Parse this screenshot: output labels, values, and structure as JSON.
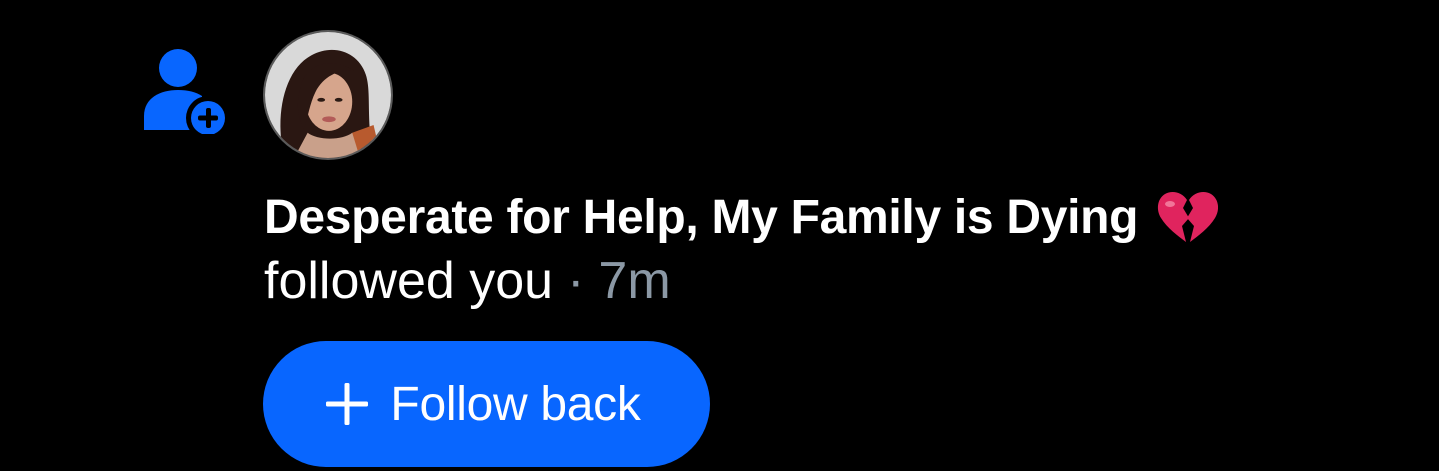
{
  "notification": {
    "type_icon": "person-add-icon",
    "avatar_icon": "user-avatar",
    "display_name": "Desperate for Help, My Family is Dying",
    "name_emoji": "broken-heart-emoji",
    "action_text": "followed you",
    "separator": "·",
    "timestamp": "7m",
    "button": {
      "icon": "plus-icon",
      "label": "Follow back"
    }
  },
  "colors": {
    "background": "#000000",
    "accent": "#0866ff",
    "primary_text": "#ffffff",
    "secondary_text": "#8b98a5",
    "emoji": "#e0245e"
  }
}
